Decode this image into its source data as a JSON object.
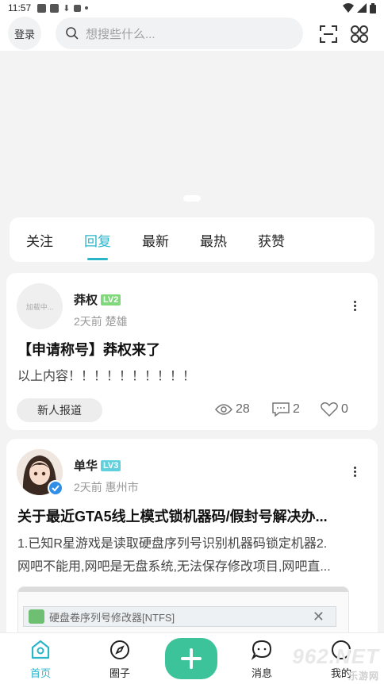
{
  "status_bar": {
    "time": "11:57"
  },
  "header": {
    "login_label": "登录",
    "search_placeholder": "想搜些什么..."
  },
  "tabs": [
    {
      "label": "关注",
      "active": false
    },
    {
      "label": "回复",
      "active": true
    },
    {
      "label": "最新",
      "active": false
    },
    {
      "label": "最热",
      "active": false
    },
    {
      "label": "获赞",
      "active": false
    }
  ],
  "posts": [
    {
      "avatar_text": "加载中...",
      "author": "莽权",
      "level": "LV2",
      "level_color": "#7fd87a",
      "meta": "2天前 楚雄",
      "title": "【申请称号】莽权来了",
      "excerpt": "以上内容！！！！！！！！！！",
      "tag": "新人报道",
      "views": "28",
      "comments": "2",
      "likes": "0"
    },
    {
      "author": "单华",
      "level": "LV3",
      "level_color": "#5fd0dc",
      "meta": "2天前 惠州市",
      "title": "关于最近GTA5线上模式锁机器码/假封号解决办...",
      "excerpt_line1": "1.已知R星游戏是读取硬盘序列号识别机器码锁定机器2.",
      "excerpt_line2": "网吧不能用,网吧是无盘系统,无法保存修改项目,网吧直...",
      "embed_title": "硬盘卷序列号修改器[NTFS]"
    }
  ],
  "bottom_nav": {
    "home": "首页",
    "circle": "圈子",
    "messages": "消息",
    "mine": "我的"
  },
  "watermark": {
    "brand": "962.NET",
    "sub": "乐游网"
  },
  "colors": {
    "accent": "#2bb5c9",
    "fab": "#3cc39a"
  }
}
